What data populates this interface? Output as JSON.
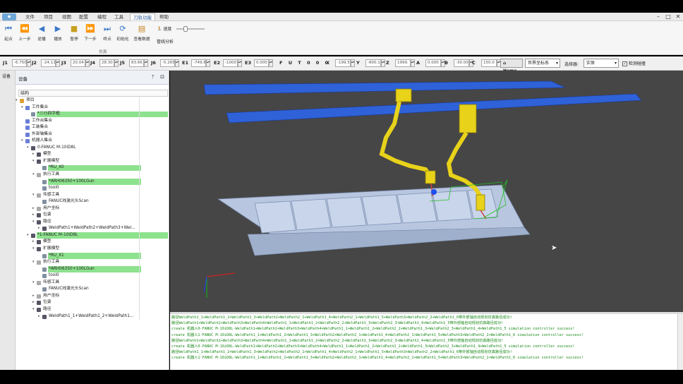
{
  "app": {
    "logo": ""
  },
  "menu": [
    "文件",
    "项目",
    "视图",
    "配置",
    "编程",
    "工具",
    "刀轨功能",
    "帮助"
  ],
  "window_controls": [
    "–",
    "□",
    "✕"
  ],
  "ribbon": {
    "buttons": [
      {
        "label": "起点",
        "icon": "skip-start-icon"
      },
      {
        "label": "上一步",
        "icon": "step-back-icon"
      },
      {
        "label": "逆播",
        "icon": "reverse-play-icon"
      },
      {
        "label": "播放",
        "icon": "play-icon"
      },
      {
        "label": "暂停",
        "icon": "pause-icon"
      },
      {
        "label": "下一步",
        "icon": "step-forward-icon"
      },
      {
        "label": "终点",
        "icon": "skip-end-icon"
      },
      {
        "label": "初始化",
        "icon": "initialize-icon"
      },
      {
        "label": "查看数据",
        "icon": "data-view-icon"
      }
    ],
    "group_label": "仿真",
    "speed_label": "速度",
    "trajectory_label": "管线分析"
  },
  "coords": [
    {
      "k": "J1",
      "v": "-6.750"
    },
    {
      "k": "J2",
      "v": "-24.11"
    },
    {
      "k": "J3",
      "v": "20.04"
    },
    {
      "k": "J4",
      "v": "28.30"
    },
    {
      "k": "J5",
      "v": "83.66"
    },
    {
      "k": "J6",
      "v": "-5.265"
    },
    {
      "k": "E1",
      "v": "-749.6"
    },
    {
      "k": "E2",
      "v": "-1000"
    },
    {
      "k": "E3",
      "v": "0.000"
    }
  ],
  "futoo": "F U T 0 0 0",
  "coords2": [
    {
      "k": "X",
      "v": "-199.5"
    },
    {
      "k": "Y",
      "v": "-800.1"
    },
    {
      "k": "Z",
      "v": "1999."
    },
    {
      "k": "A",
      "v": "0.000"
    },
    {
      "k": "B",
      "v": "-30.00"
    },
    {
      "k": "C",
      "v": "150.0"
    }
  ],
  "home_label": "Home",
  "frame_select": "世界坐标系",
  "filter_label": "选择器:",
  "filter_value": "实体",
  "check_label": "检测碰撞",
  "side_tab": "设备",
  "panel": {
    "title": "设备",
    "struct": "结构"
  },
  "tree": [
    {
      "d": 0,
      "t": "项目",
      "ic": "#e0a030",
      "tg": "▾"
    },
    {
      "d": 1,
      "t": "工件集合",
      "ic": "#6a7fd8",
      "tg": "▾"
    },
    {
      "d": 2,
      "t": "*三行四字框",
      "ic": "#8090a0",
      "hl": true
    },
    {
      "d": 1,
      "t": "工作台集合",
      "ic": "#6a7fd8"
    },
    {
      "d": 1,
      "t": "工装集合",
      "ic": "#6a7fd8"
    },
    {
      "d": 1,
      "t": "外部轴集合",
      "ic": "#6a7fd8"
    },
    {
      "d": 1,
      "t": "机器人集合",
      "ic": "#6a7fd8",
      "tg": "▾"
    },
    {
      "d": 2,
      "t": "0-FANUC M-10iD8L",
      "ic": "#556",
      "tg": "▾"
    },
    {
      "d": 3,
      "t": "模型",
      "ic": "#556",
      "tg": "▸"
    },
    {
      "d": 3,
      "t": "扩展模型",
      "ic": "#556",
      "tg": "▾"
    },
    {
      "d": 4,
      "t": "*RU_X0",
      "ic": "#8090a0",
      "hl": true
    },
    {
      "d": 3,
      "t": "执行工具",
      "ic": "#aaa",
      "tg": "▾"
    },
    {
      "d": 4,
      "t": "*ARH06350+100LGun",
      "ic": "#8090a0",
      "hl": true
    },
    {
      "d": 4,
      "t": "tool0",
      "ic": "#8090a0"
    },
    {
      "d": 3,
      "t": "传感工具",
      "ic": "#aaa",
      "tg": "▾"
    },
    {
      "d": 4,
      "t": "FANUC线激光头Scan",
      "ic": "#8090a0"
    },
    {
      "d": 3,
      "t": "用户坐标",
      "ic": "#aaa",
      "tg": "▸"
    },
    {
      "d": 3,
      "t": "位姿",
      "ic": "#556",
      "tg": "▸"
    },
    {
      "d": 3,
      "t": "路径",
      "ic": "#556",
      "tg": "▾"
    },
    {
      "d": 4,
      "t": "WeldPath1+WeldPath2+WeldPath3+Wel...",
      "ic": "#556",
      "tg": "▸"
    },
    {
      "d": 2,
      "t": "*1-FANUC M-10iD8L",
      "ic": "#556",
      "tg": "▾",
      "hl": true
    },
    {
      "d": 3,
      "t": "模型",
      "ic": "#556",
      "tg": "▸"
    },
    {
      "d": 3,
      "t": "扩展模型",
      "ic": "#556",
      "tg": "▾"
    },
    {
      "d": 4,
      "t": "*RU_X1",
      "ic": "#8090a0",
      "hl": true
    },
    {
      "d": 3,
      "t": "执行工具",
      "ic": "#aaa",
      "tg": "▾"
    },
    {
      "d": 4,
      "t": "*ARH06350+100LGun",
      "ic": "#8090a0",
      "hl": true
    },
    {
      "d": 4,
      "t": "tool0",
      "ic": "#8090a0"
    },
    {
      "d": 3,
      "t": "传感工具",
      "ic": "#aaa",
      "tg": "▾"
    },
    {
      "d": 4,
      "t": "FANUC线激光头Scan",
      "ic": "#8090a0"
    },
    {
      "d": 3,
      "t": "用户坐标",
      "ic": "#aaa",
      "tg": "▸"
    },
    {
      "d": 3,
      "t": "位姿",
      "ic": "#556",
      "tg": "▸"
    },
    {
      "d": 3,
      "t": "路径",
      "ic": "#556",
      "tg": "▾"
    },
    {
      "d": 4,
      "t": "WeldPath1_1+WeldPath1_2+WeldPath1...",
      "ic": "#556",
      "tg": "▸"
    }
  ],
  "log": [
    "路径WeldPath1_1+WeldPath1_2+WeldPath1_3+WeldPath2+WeldPath2_1+WeldPath1_4+WeldPath2_1+WeldPath1_5+WeldPath3+WeldPath2_2+WeldPath1_6带外部轴自动规划仿真路径成功!",
    "路径WeldPath1+WeldPath2+WeldPath3+WeldPath4+WeldPath1_1+WeldPath1_2+WeldPath2_2+WeldPath1_3+WeldPath2_3+WeldPath1_4+WeldPath1_5带外部轴自动规划仿真路径成功!",
    "create 机器人0-FANUC M-10iD8L-WeldPath1+WeldPath2+WeldPath3+WeldPath4+WeldPath1_1+WeldPath1_2+WeldPath2_2+WeldPath1_3+WeldPath2_3+WeldPath1_4+WeldPath1_5 simulation controller success!",
    "create 机器人1-FANUC M-10iD8L-WeldPath1_1+WeldPath1_2+WeldPath1_3+WeldPath2+WeldPath2_1+WeldPath1_4+WeldPath2_1+WeldPath1_5+WeldPath3+WeldPath2_2+WeldPath1_6 simulation controller success!",
    "路径WeldPath1+WeldPath2+WeldPath3+WeldPath4+WeldPath1_1+WeldPath1_2+WeldPath2_2+WeldPath1_3+WeldPath2_3+WeldPath1_4+WeldPath1_5带外部轴自动规划仿真路径成功!",
    "create 机器人0-FANUC M-10iD8L-WeldPath1+WeldPath2+WeldPath3+WeldPath4+WeldPath1_1+WeldPath1_2+WeldPath2_2+WeldPath1_3+WeldPath2_3+WeldPath1_4+WeldPath1_5 simulation controller success!",
    "路径WeldPath1_1+WeldPath1_2+WeldPath1_3+WeldPath2+WeldPath2_1+WeldPath1_4+WeldPath2_1+WeldPath1_5+WeldPath3+WeldPath2_2+WeldPath1_6带外部轴自动规划仿真路径成功!",
    "create 机器人1-FANUC M-10iD8L-WeldPath1_1+WeldPath1_2+WeldPath1_3+WeldPath2+WeldPath2_1+WeldPath1_4+WeldPath2_1+WeldPath1_5+WeldPath3+WeldPath2_2+WeldPath1_6 simulation controller success!"
  ],
  "colors": {
    "highlight": "#8de28d",
    "robot": "#e8d21a",
    "rail": "#2f62d8",
    "log_text": "#1a8a1a"
  }
}
